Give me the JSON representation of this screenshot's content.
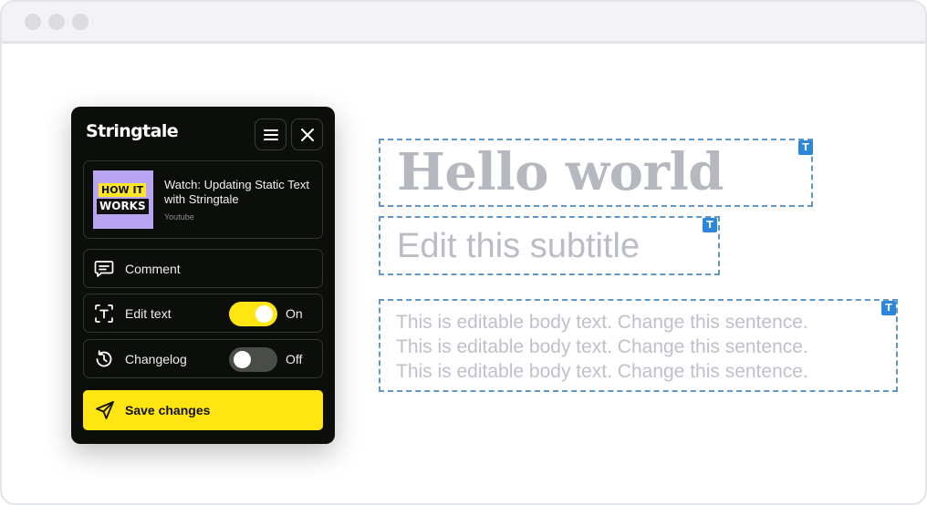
{
  "panel": {
    "brand": "Stringtale",
    "video": {
      "thumb_line1": "HOW IT",
      "thumb_line2": "WORKS",
      "title": "Watch: Updating Static Text with Stringtale",
      "source": "Youtube"
    },
    "comment_label": "Comment",
    "edit_text": {
      "label": "Edit text",
      "state_label": "On",
      "enabled": true
    },
    "changelog": {
      "label": "Changelog",
      "state_label": "Off",
      "enabled": false
    },
    "save_label": "Save changes"
  },
  "canvas": {
    "title": "Hello world",
    "subtitle": "Edit this subtitle",
    "body_lines": [
      "This is editable body text. Change this sentence.",
      "This is editable body text. Change this sentence.",
      "This is editable body text. Change this sentence."
    ],
    "tag_letter": "T"
  },
  "colors": {
    "accent": "#ffe612",
    "panel_bg": "#0c0f09",
    "edit_border": "#5f98c8",
    "tag_bg": "#2c86d9"
  }
}
